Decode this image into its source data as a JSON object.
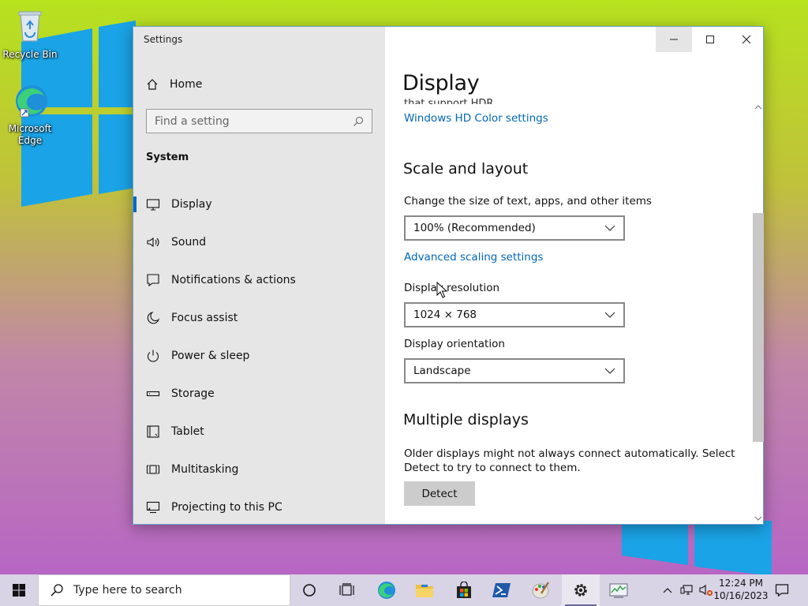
{
  "desktop": {
    "icons": [
      {
        "label": "Recycle Bin"
      },
      {
        "label": "Microsoft Edge"
      }
    ]
  },
  "window": {
    "title": "Settings",
    "sidebar": {
      "home_label": "Home",
      "search_placeholder": "Find a setting",
      "section_label": "System",
      "items": [
        {
          "label": "Display",
          "icon": "monitor-icon",
          "active": true
        },
        {
          "label": "Sound",
          "icon": "speaker-icon"
        },
        {
          "label": "Notifications & actions",
          "icon": "notification-icon"
        },
        {
          "label": "Focus assist",
          "icon": "moon-icon"
        },
        {
          "label": "Power & sleep",
          "icon": "power-icon"
        },
        {
          "label": "Storage",
          "icon": "storage-icon"
        },
        {
          "label": "Tablet",
          "icon": "tablet-icon"
        },
        {
          "label": "Multitasking",
          "icon": "multitasking-icon"
        },
        {
          "label": "Projecting to this PC",
          "icon": "projecting-icon"
        }
      ]
    },
    "content": {
      "title": "Display",
      "clipped_text": "that support HDR",
      "hd_color_link": "Windows HD Color settings",
      "scale_section": "Scale and layout",
      "scale_label": "Change the size of text, apps, and other items",
      "scale_value": "100% (Recommended)",
      "advanced_link": "Advanced scaling settings",
      "resolution_label": "Display resolution",
      "resolution_value": "1024 × 768",
      "orientation_label": "Display orientation",
      "orientation_value": "Landscape",
      "multi_section": "Multiple displays",
      "multi_desc": "Older displays might not always connect automatically. Select Detect to try to connect to them.",
      "detect_button": "Detect"
    }
  },
  "taskbar": {
    "search_placeholder": "Type here to search",
    "clock_time": "12:24 PM",
    "clock_date": "10/16/2023"
  },
  "colors": {
    "accent": "#0067c0",
    "link": "#0067b8",
    "sidebar_bg": "#e6e6e6",
    "taskbar_bg": "#d9d3e6"
  }
}
